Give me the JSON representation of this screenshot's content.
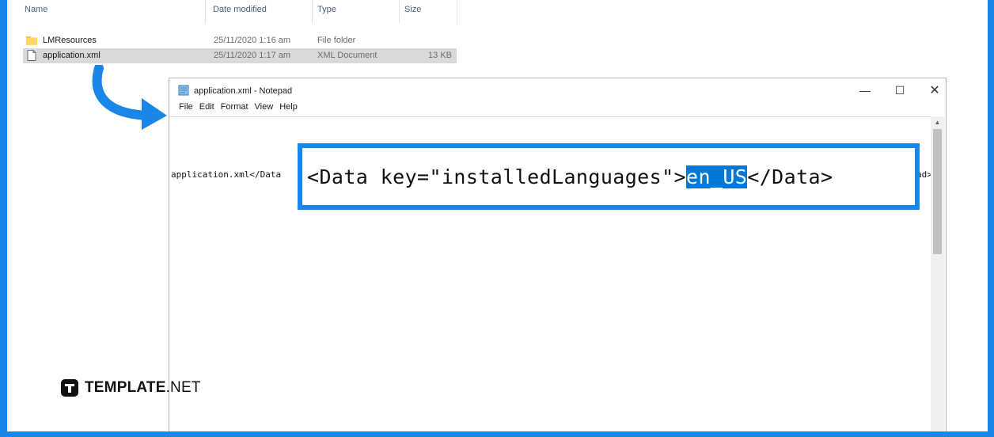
{
  "explorer": {
    "columns": {
      "name": "Name",
      "date": "Date modified",
      "type": "Type",
      "size": "Size"
    },
    "files": [
      {
        "name": "LMResources",
        "date": "25/11/2020 1:16 am",
        "type": "File folder",
        "size": "",
        "icon": "folder-icon",
        "selected": false
      },
      {
        "name": "application.xml",
        "date": "25/11/2020 1:17 am",
        "type": "XML Document",
        "size": "13 KB",
        "icon": "file-icon",
        "selected": true
      }
    ]
  },
  "notepad": {
    "title": "application.xml - Notepad",
    "menu": [
      "File",
      "Edit",
      "Format",
      "View",
      "Help"
    ],
    "line_left": "application.xml</Data",
    "line_right": "ad>",
    "window_buttons": {
      "minimize": "—",
      "maximize": "☐",
      "close": "✕"
    }
  },
  "highlight": {
    "before": "<Data key=\"installedLanguages\">",
    "selected": "en_US",
    "after": "</Data>"
  },
  "logo": {
    "bold": "TEMPLATE",
    "light": ".NET"
  },
  "colors": {
    "accent": "#1a86e8",
    "selection": "#0078d7"
  }
}
